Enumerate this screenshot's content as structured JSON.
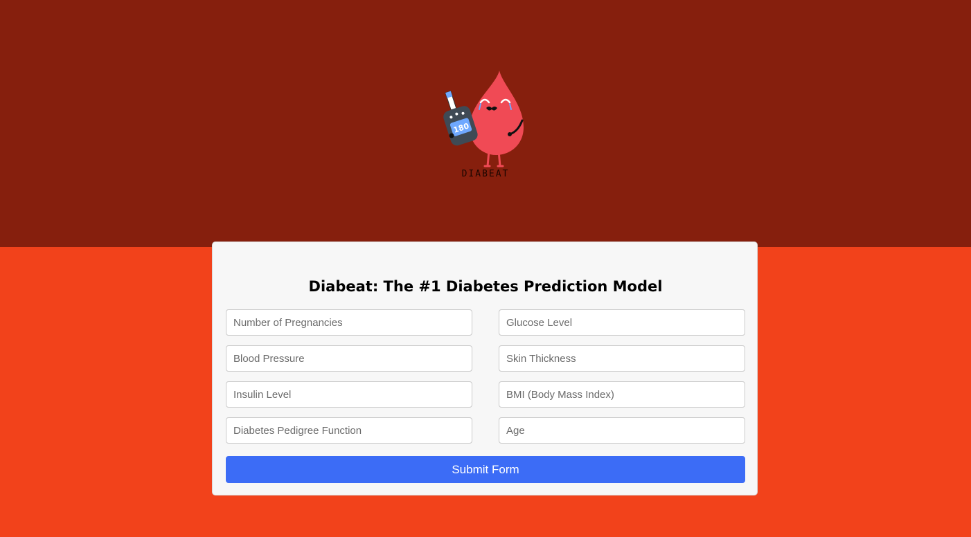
{
  "brand": {
    "logo_text": "DIABEAT",
    "glucose_reading": "180",
    "mascot_icon": "blood-drop-mascot-with-glucometer-icon"
  },
  "colors": {
    "header_bg": "#861f0d",
    "body_bg": "#f2421b",
    "card_bg": "#f7f7f7",
    "button_bg": "#3c6cf6",
    "mascot": "#f04a55"
  },
  "form": {
    "title": "Diabeat: The #1 Diabetes Prediction Model",
    "fields": {
      "pregnancies": {
        "placeholder": "Number of Pregnancies",
        "value": ""
      },
      "glucose": {
        "placeholder": "Glucose Level",
        "value": ""
      },
      "blood_pressure": {
        "placeholder": "Blood Pressure",
        "value": ""
      },
      "skin_thickness": {
        "placeholder": "Skin Thickness",
        "value": ""
      },
      "insulin": {
        "placeholder": "Insulin Level",
        "value": ""
      },
      "bmi": {
        "placeholder": "BMI (Body Mass Index)",
        "value": ""
      },
      "pedigree": {
        "placeholder": "Diabetes Pedigree Function",
        "value": ""
      },
      "age": {
        "placeholder": "Age",
        "value": ""
      }
    },
    "submit_label": "Submit Form"
  }
}
